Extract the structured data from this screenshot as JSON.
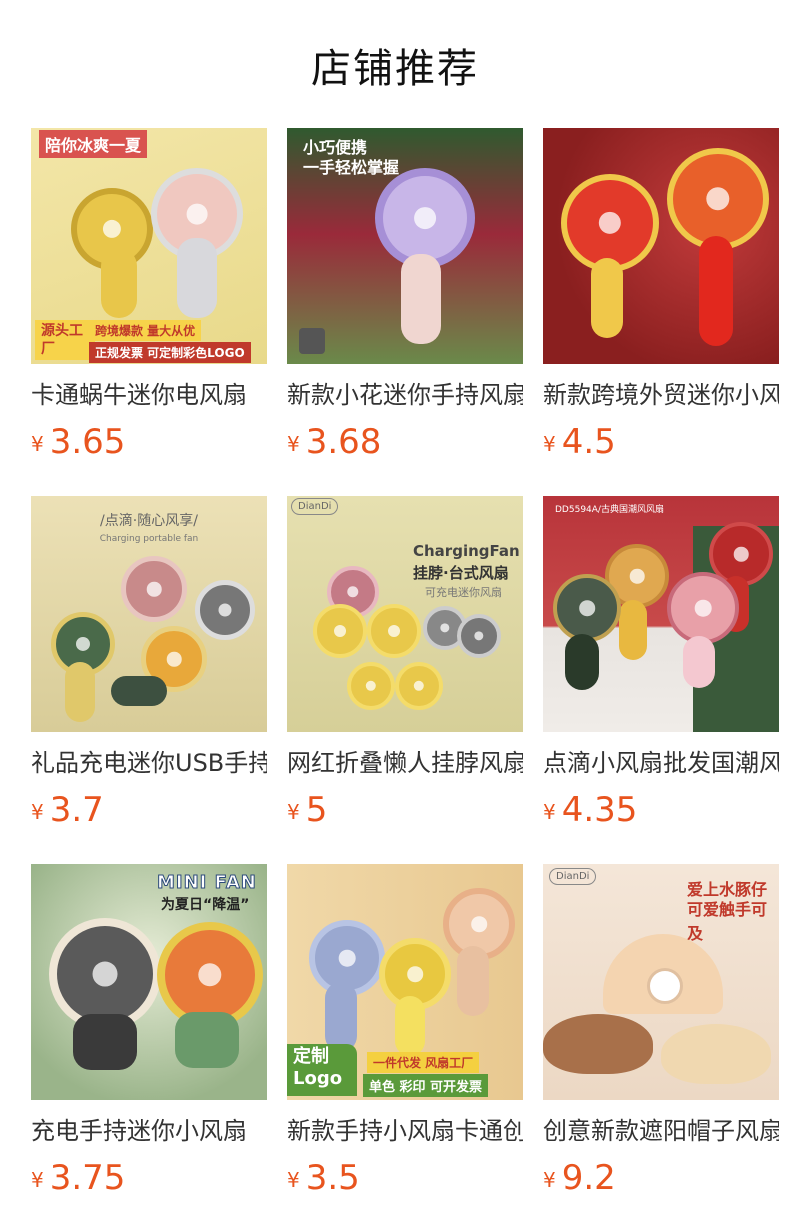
{
  "page_title": "店铺推荐",
  "currency": "¥",
  "colors": {
    "price": "#e8541e",
    "title": "#111111"
  },
  "products": [
    {
      "name": "卡通蜗牛迷你电风扇",
      "price": "3.65",
      "image_text": {
        "top": "陪你冰爽一夏",
        "badge": "源头工厂",
        "line1": "跨境爆款 量大从优",
        "line2": "正规发票 可定制彩色LOGO"
      }
    },
    {
      "name": "新款小花迷你手持风扇",
      "price": "3.68",
      "image_text": {
        "top": "小巧便携",
        "sub": "一手轻松掌握"
      }
    },
    {
      "name": "新款跨境外贸迷你小风扇",
      "price": "4.5",
      "image_text": {}
    },
    {
      "name": "礼品充电迷你USB手持风扇",
      "price": "3.7",
      "image_text": {
        "top": "/点滴·随心风享/",
        "sub": "Charging portable fan"
      }
    },
    {
      "name": "网红折叠懒人挂脖风扇",
      "price": "5",
      "image_text": {
        "brand": "DianDi",
        "top": "ChargingFan",
        "sub": "挂脖·台式风扇",
        "small": "可充电迷你风扇"
      }
    },
    {
      "name": "点滴小风扇批发国潮风",
      "price": "4.35",
      "image_text": {
        "top": "DD5594A/古典国潮风风扇"
      }
    },
    {
      "name": "充电手持迷你小风扇",
      "price": "3.75",
      "image_text": {
        "top": "MINI FAN",
        "sub": "为夏日“降温”"
      }
    },
    {
      "name": "新款手持小风扇卡通创意",
      "price": "3.5",
      "image_text": {
        "badge": "定制Logo",
        "line1": "一件代发 风扇工厂",
        "line2": "单色 彩印 可开发票"
      }
    },
    {
      "name": "创意新款遮阳帽子风扇",
      "price": "9.2",
      "image_text": {
        "brand": "DianDi",
        "top": "爱上水豚仔",
        "sub": "可爱触手可及"
      }
    }
  ]
}
